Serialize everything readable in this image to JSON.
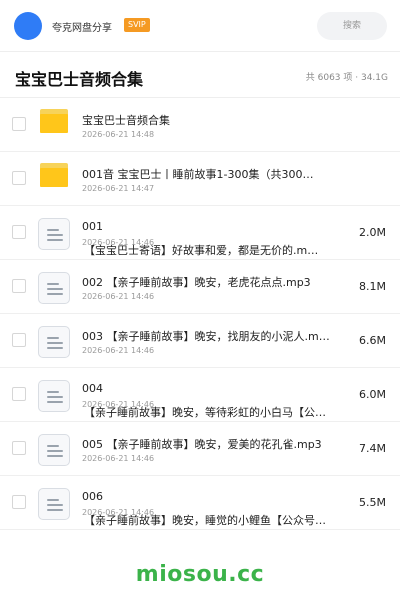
{
  "header": {
    "brand": "夸克网盘分享",
    "badge": "SVIP",
    "search_placeholder": "搜索"
  },
  "folder": {
    "title": "宝宝巴士音频合集",
    "stats": "共 6063 项 · 34.1G"
  },
  "items": [
    {
      "type": "folder",
      "name": "宝宝巴士音频合集",
      "date": "2026-06-21 14:48",
      "size": ""
    },
    {
      "type": "folder",
      "name": "001音 宝宝巴士丨睡前故事1-300集（共300…",
      "date": "2026-06-21 14:47",
      "size": ""
    },
    {
      "type": "file",
      "name": "001",
      "name2": "【宝宝巴士寄语】好故事和爱，都是无价的.m…",
      "date": "2026-06-21 14:46",
      "size": "2.0M"
    },
    {
      "type": "file",
      "name": "002 【亲子睡前故事】晚安，老虎花点点.mp3",
      "date": "2026-06-21 14:46",
      "size": "8.1M"
    },
    {
      "type": "file",
      "name": "003 【亲子睡前故事】晚安，找朋友的小泥人.mp3",
      "date": "2026-06-21 14:46",
      "size": "6.6M"
    },
    {
      "type": "file",
      "name": "004",
      "name2": "【亲子睡前故事】晚安，等待彩虹的小白马【公…",
      "date": "2026-06-21 14:46",
      "size": "6.0M"
    },
    {
      "type": "file",
      "name": "005 【亲子睡前故事】晚安，爱美的花孔雀.mp3",
      "date": "2026-06-21 14:46",
      "size": "7.4M"
    },
    {
      "type": "file",
      "name": "006",
      "name2": "【亲子睡前故事】晚安，睡觉的小鲤鱼【公众号…",
      "date": "2026-06-21 14:46",
      "size": "5.5M"
    }
  ],
  "footer": {
    "watermark": "miosou.cc"
  },
  "colors": {
    "accent": "#2f7cf6",
    "folder": "#ffc61a",
    "svip": "#f59a23",
    "watermark": "#3bb34a"
  }
}
